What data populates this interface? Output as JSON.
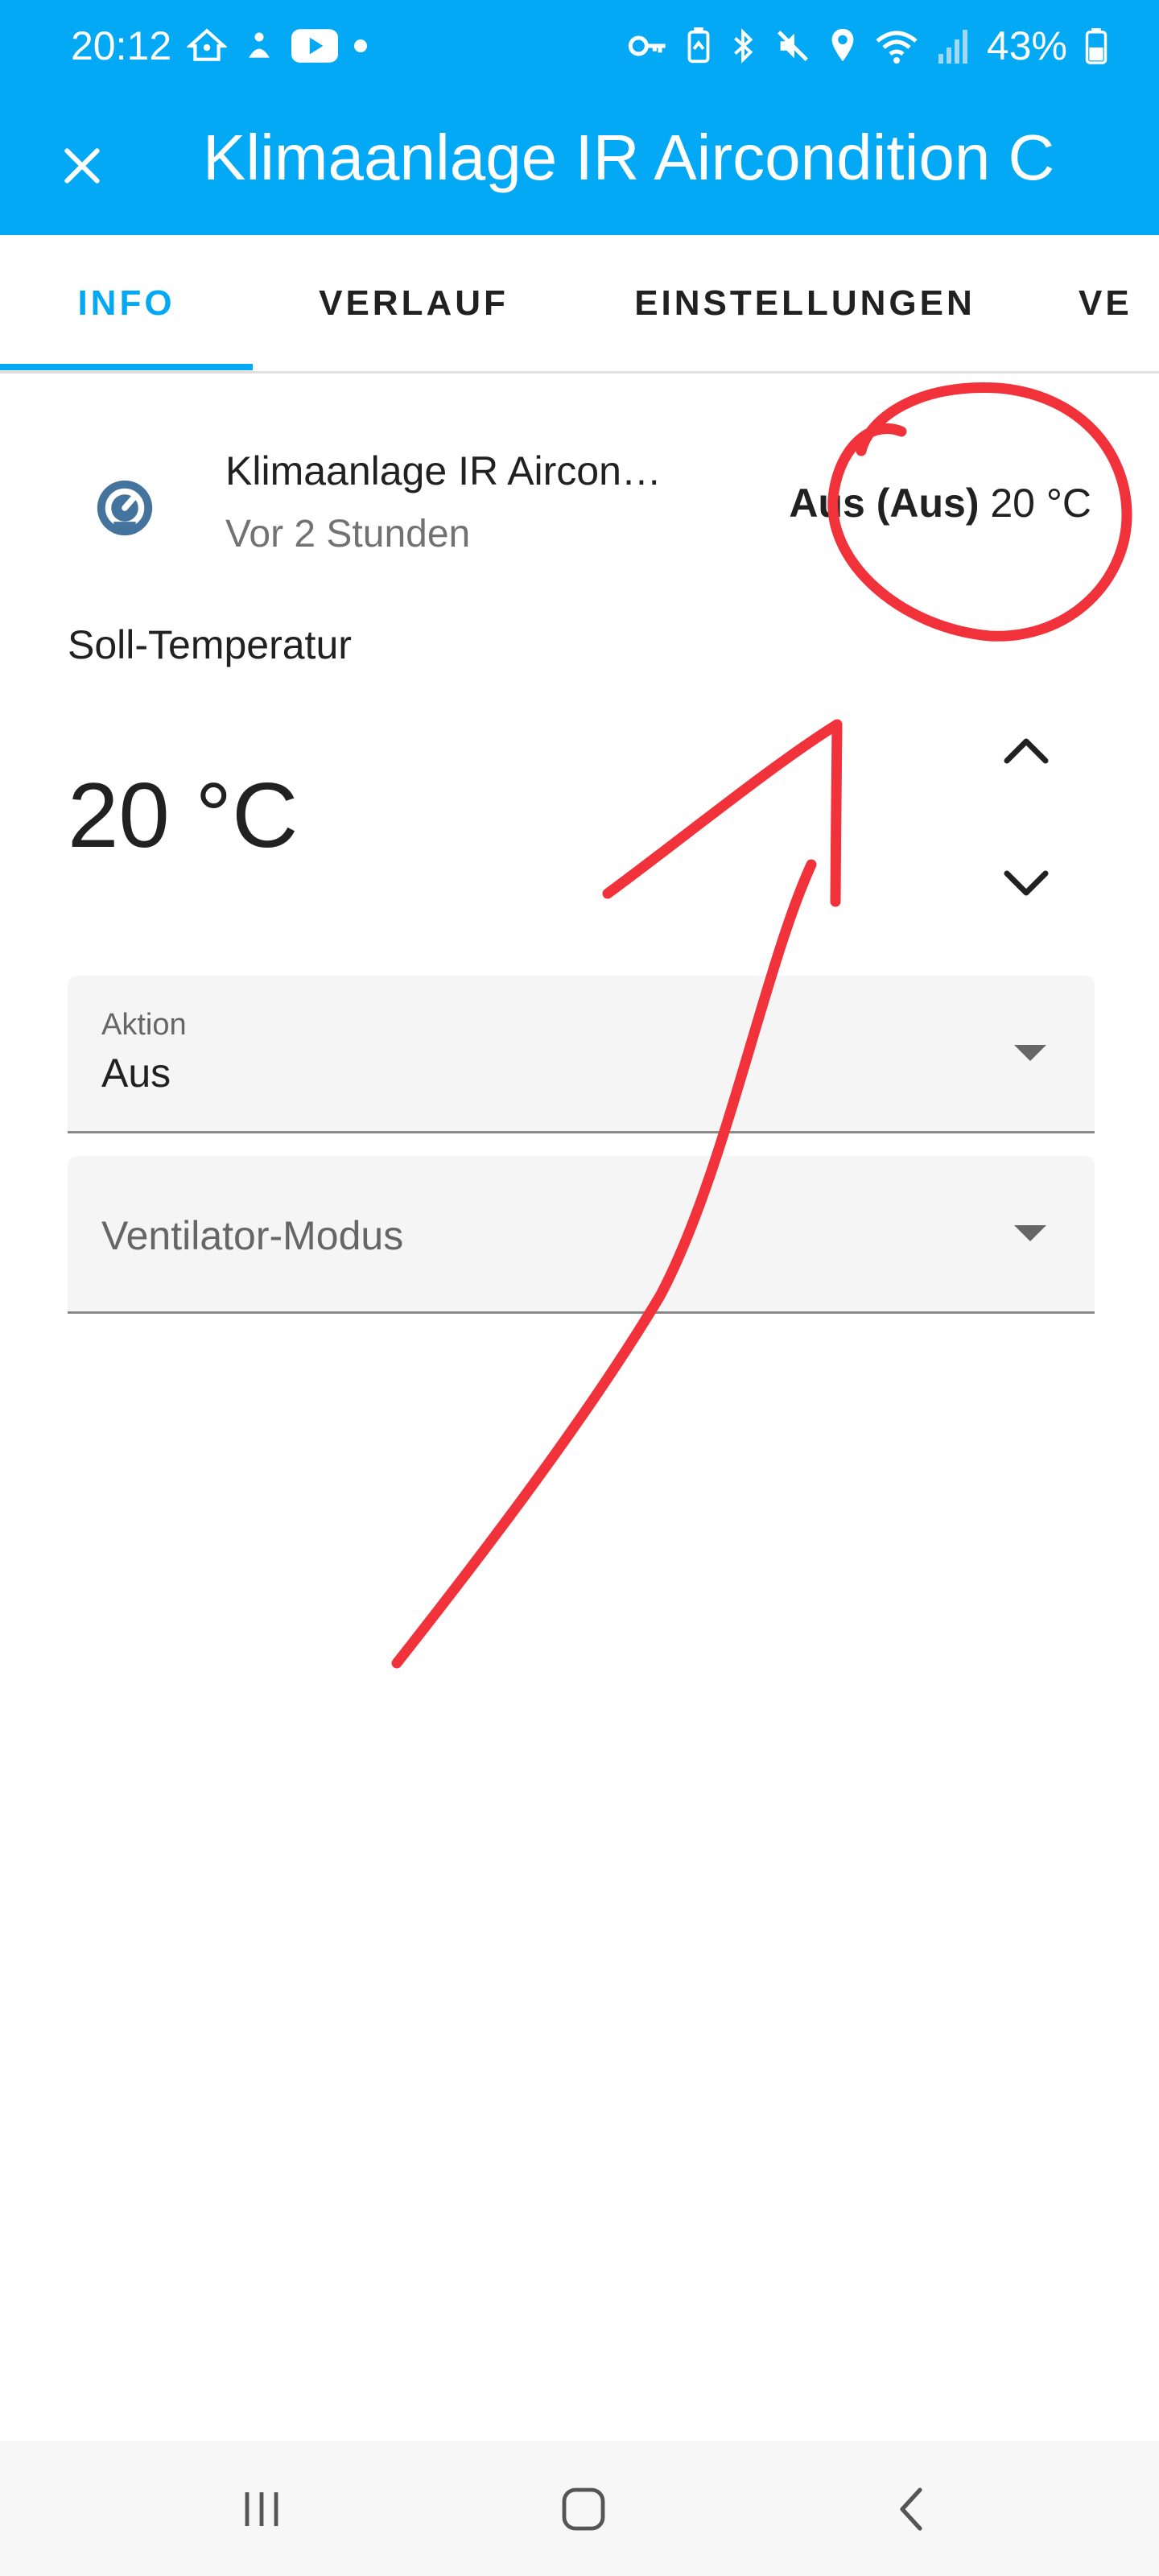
{
  "status_bar": {
    "time": "20:12",
    "battery": "43%",
    "left_icons": [
      "home-assistant-icon",
      "notification-app-icon",
      "youtube-icon",
      "dot-icon"
    ],
    "right_icons": [
      "vpn-key-icon",
      "battery-saver-icon",
      "bluetooth-icon",
      "mute-icon",
      "location-icon",
      "wifi-icon",
      "signal-icon",
      "battery-icon"
    ]
  },
  "app_bar": {
    "title": "Klimaanlage IR Aircondition C",
    "close_icon": "close-icon",
    "background": "#03a9f4"
  },
  "tabs": [
    {
      "label": "INFO",
      "active": true
    },
    {
      "label": "VERLAUF",
      "active": false
    },
    {
      "label": "EINSTELLUNGEN",
      "active": false
    },
    {
      "label": "VE",
      "active": false
    }
  ],
  "entity": {
    "name": "Klimaanlage IR Aircon…",
    "last_changed": "Vor 2 Stunden",
    "state_bold": "Aus (Aus)",
    "state_temp": "20 °C",
    "icon": "thermostat-icon"
  },
  "target_temperature": {
    "label": "Soll-Temperatur",
    "value": "20 °C"
  },
  "selects": {
    "aktion": {
      "label": "Aktion",
      "value": "Aus"
    },
    "ventilator": {
      "placeholder": "Ventilator-Modus"
    }
  },
  "colors": {
    "accent": "#03a9f4",
    "annotation": "#f2323a"
  }
}
